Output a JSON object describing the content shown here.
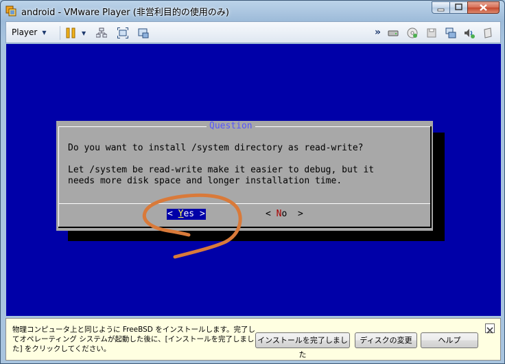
{
  "window": {
    "title": "android - VMware Player (非営利目的の使用のみ)",
    "icon": "vmware-app-icon"
  },
  "toolbar": {
    "player_label": "Player",
    "icons": [
      "pause-icon",
      "network-icon",
      "fullscreen-icon",
      "unity-icon",
      "cd-drive-icon",
      "hard-disk-icon",
      "floppy-icon",
      "network-adapter-icon",
      "sound-icon",
      "usb-icon"
    ],
    "overflow_label": "»"
  },
  "guest": {
    "dialog_title": "Question",
    "question_line": "Do you want to install /system directory as read-write?",
    "info_line1": "Let /system be read-write make it easier to debug, but it",
    "info_line2": "needs more disk space and longer installation time.",
    "yes": {
      "left": "< ",
      "hot": "Y",
      "rest": "es",
      "right": " >"
    },
    "no": {
      "left": "< ",
      "hot": "N",
      "rest": "o",
      "right": "  >"
    },
    "colors": {
      "background": "#0000a8",
      "dialog": "#a8a8a8",
      "title": "#5656fc",
      "annotation": "#d97a3a"
    }
  },
  "notification": {
    "message": "物理コンピュータ上と同じように FreeBSD をインストールします。完了してオペレーティング システムが起動した後に、[インストールを完了しました] をクリックしてください。",
    "button_done": "インストールを完了しました",
    "button_change_disk": "ディスクの変更",
    "button_help": "ヘルプ"
  }
}
